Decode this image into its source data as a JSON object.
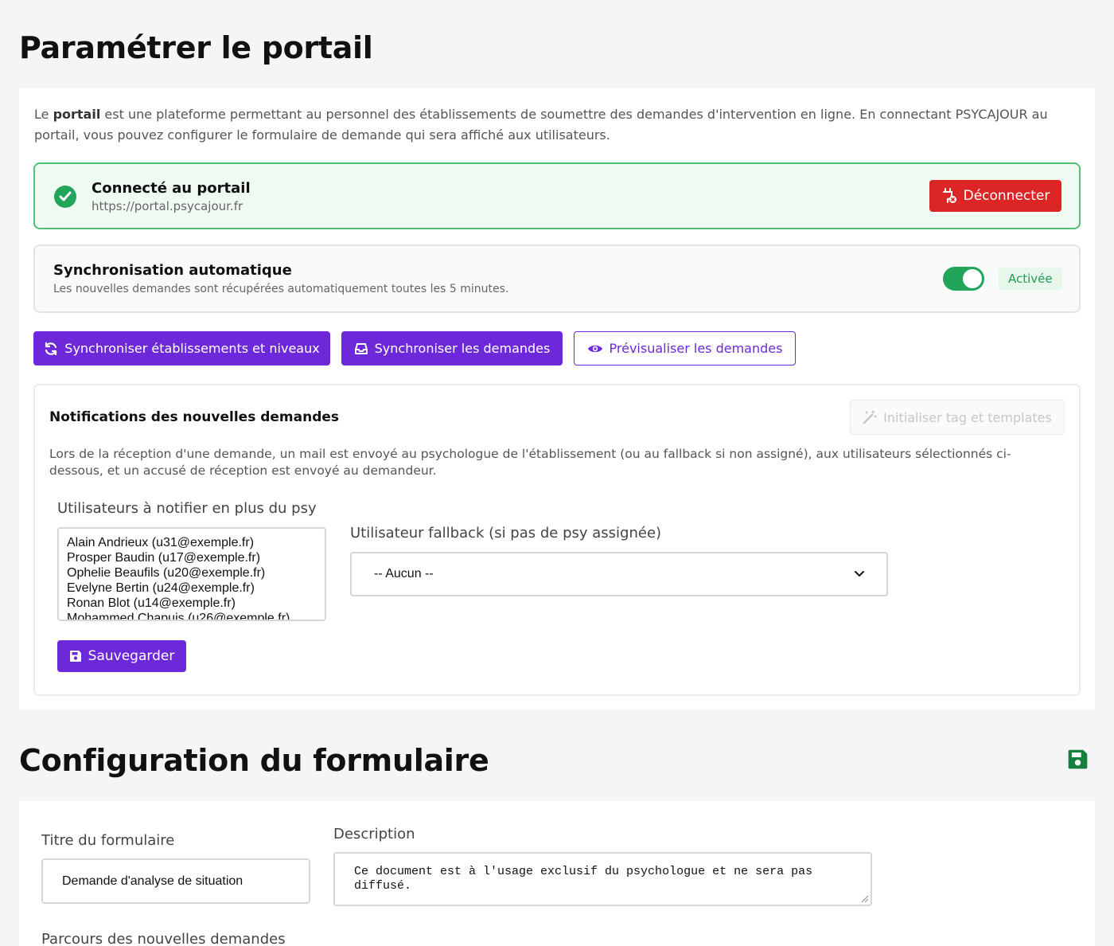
{
  "page": {
    "title": "Paramétrer le portail"
  },
  "intro": {
    "lead": "Le ",
    "bold": "portail",
    "rest": " est une plateforme permettant au personnel des établissements de soumettre des demandes d'intervention en ligne. En connectant PSYCAJOUR au portail, vous pouvez configurer le formulaire de demande qui sera affiché aux utilisateurs."
  },
  "connection": {
    "title": "Connecté au portail",
    "url": "https://portal.psycajour.fr",
    "disconnect_label": "Déconnecter",
    "status_color": "#21a55a"
  },
  "auto_sync": {
    "title": "Synchronisation automatique",
    "description": "Les nouvelles demandes sont récupérées automatiquement toutes les 5 minutes.",
    "enabled": true,
    "badge": "Activée"
  },
  "actions": {
    "sync_establishments": "Synchroniser établissements et niveaux",
    "sync_requests": "Synchroniser les demandes",
    "preview_requests": "Prévisualiser les demandes"
  },
  "notifications": {
    "title": "Notifications des nouvelles demandes",
    "init_button": "Initialiser tag et templates",
    "description": "Lors de la réception d'une demande, un mail est envoyé au psychologue de l'établissement (ou au fallback si non assigné), aux utilisateurs sélectionnés ci-dessous, et un accusé de réception est envoyé au demandeur.",
    "users_label": "Utilisateurs à notifier en plus du psy",
    "users": [
      "Alain Andrieux (u31@exemple.fr)",
      "Prosper Baudin (u17@exemple.fr)",
      "Ophelie Beaufils (u20@exemple.fr)",
      "Evelyne Bertin (u24@exemple.fr)",
      "Ronan Blot (u14@exemple.fr)",
      "Mohammed Chapuis (u26@exemple.fr)"
    ],
    "fallback_label": "Utilisateur fallback (si pas de psy assignée)",
    "fallback_value": "-- Aucun --",
    "save_label": "Sauvegarder"
  },
  "form_config": {
    "section_title": "Configuration du formulaire",
    "title_label": "Titre du formulaire",
    "title_value": "Demande d'analyse de situation",
    "description_label": "Description",
    "description_value": "Ce document est à l'usage exclusif du psychologue et ne sera pas diffusé.",
    "parcours_label": "Parcours des nouvelles demandes"
  },
  "colors": {
    "primary": "#6d28d9",
    "danger": "#dc2626",
    "success": "#21a55a"
  },
  "icons": {
    "connected": "check-circle-icon",
    "disconnect": "plug-icon",
    "sync_establishments": "refresh-icon",
    "sync_requests": "inbox-icon",
    "preview": "eye-icon",
    "init": "magic-wand-icon",
    "save": "floppy-icon"
  }
}
